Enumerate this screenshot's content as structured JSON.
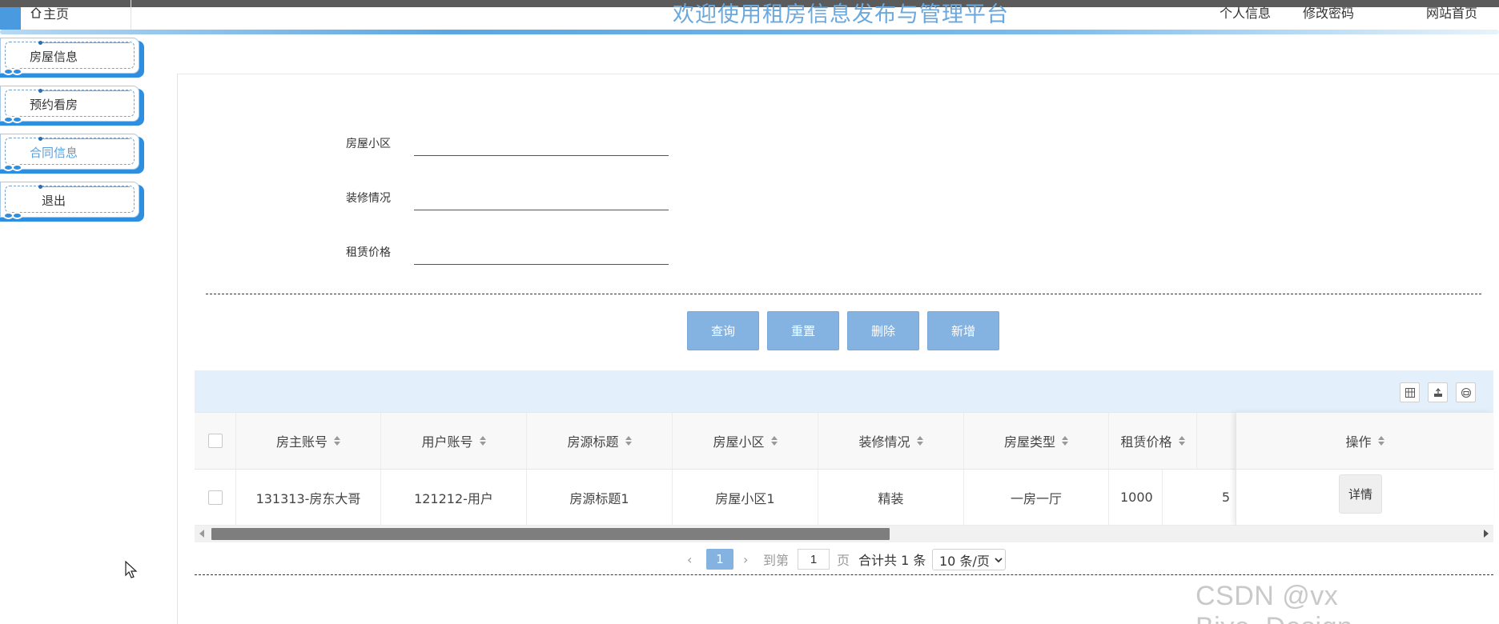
{
  "header": {
    "home_label": "主页",
    "title": "欢迎使用租房信息发布与管理平台",
    "nav": [
      "个人信息",
      "修改密码",
      "网站首页"
    ]
  },
  "sidebar": {
    "items": [
      {
        "label": "房屋信息",
        "active": false
      },
      {
        "label": "预约看房",
        "active": false
      },
      {
        "label": "合同信息",
        "active": true
      },
      {
        "label": "退出",
        "active": false
      }
    ]
  },
  "search": {
    "fields": [
      {
        "label": "房屋小区",
        "value": ""
      },
      {
        "label": "装修情况",
        "value": ""
      },
      {
        "label": "租赁价格",
        "value": ""
      }
    ],
    "buttons": [
      "查询",
      "重置",
      "删除",
      "新增"
    ]
  },
  "table": {
    "toolbar_icons": [
      "columns-icon",
      "export-icon",
      "print-icon"
    ],
    "columns": [
      "房主账号",
      "用户账号",
      "房源标题",
      "房屋小区",
      "装修情况",
      "房屋类型",
      "租赁价格"
    ],
    "action_column": "操作",
    "rows": [
      {
        "cells": [
          "131313-房东大哥",
          "121212-用户",
          "房源标题1",
          "房屋小区1",
          "精装",
          "一房一厅",
          "1000"
        ],
        "partial": "5",
        "action": "详情"
      }
    ]
  },
  "pagination": {
    "current": "1",
    "goto_prefix": "到第",
    "goto_value": "1",
    "page_suffix": "页",
    "total": "合计共 1 条",
    "page_size": "10 条/页"
  },
  "watermark": "CSDN @vx Biye_Design",
  "colors": {
    "accent": "#84b2e1",
    "sidebar_blue": "#2e8fe0",
    "title": "#6aa8dd",
    "toolbar_bg": "#e3f0fc"
  }
}
